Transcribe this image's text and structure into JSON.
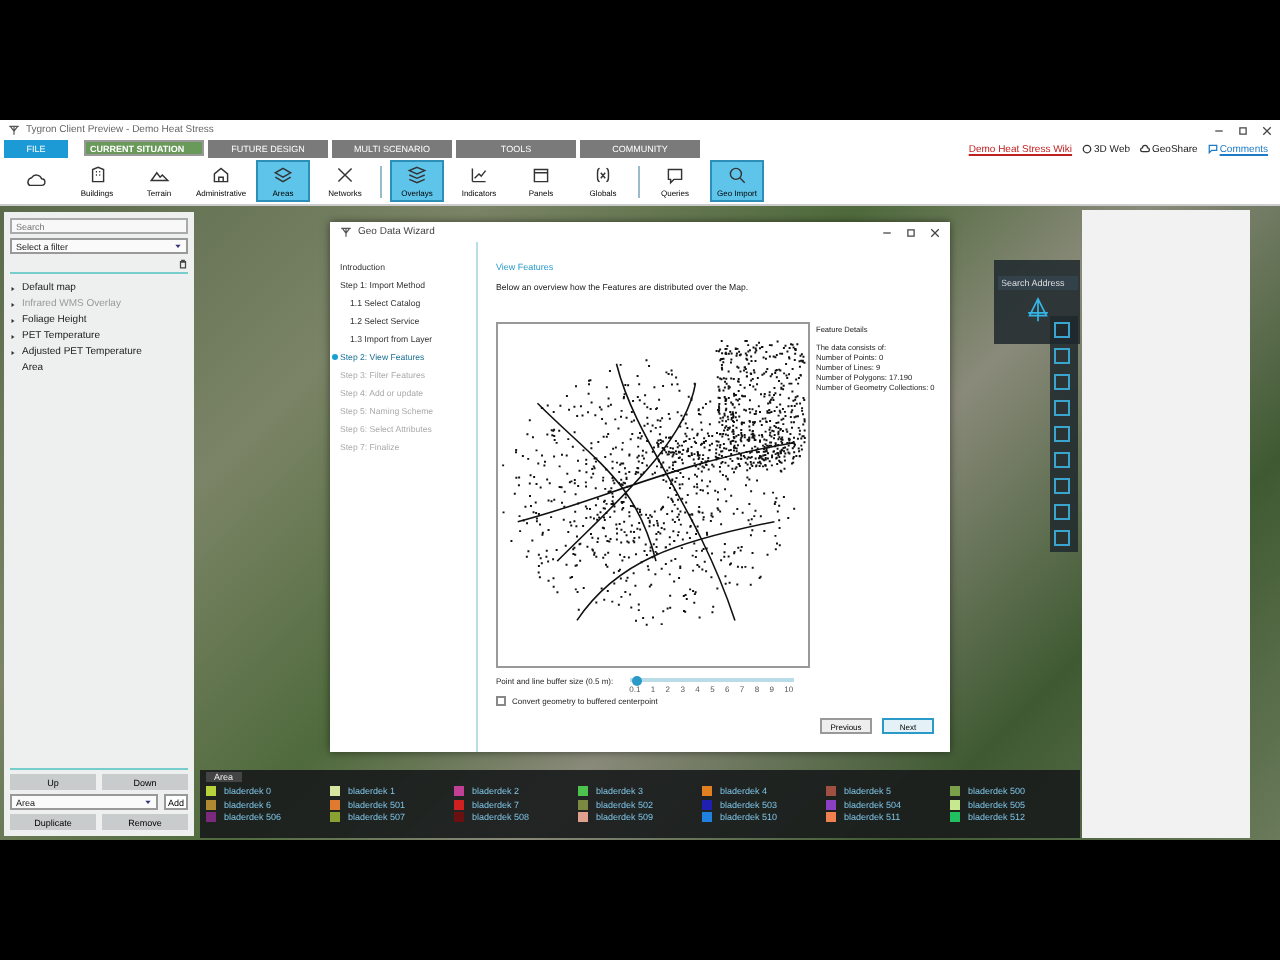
{
  "window": {
    "title": "Tygron Client Preview - Demo Heat Stress"
  },
  "tabs": [
    {
      "label": "FILE",
      "selected": false,
      "color": "#1c9ad6"
    },
    {
      "label": "CURRENT SITUATION",
      "selected": true,
      "color": "#6a9a5a"
    },
    {
      "label": "FUTURE DESIGN",
      "selected": false,
      "color": "#7a7a7a"
    },
    {
      "label": "MULTI SCENARIO",
      "selected": false,
      "color": "#7a7a7a"
    },
    {
      "label": "TOOLS",
      "selected": false,
      "color": "#7a7a7a"
    },
    {
      "label": "COMMUNITY",
      "selected": false,
      "color": "#7a7a7a"
    }
  ],
  "header_links": [
    {
      "label": "Demo Heat Stress Wiki",
      "kind": "link"
    },
    {
      "label": "3D Web",
      "kind": "globe"
    },
    {
      "label": "GeoShare",
      "kind": "cloud"
    },
    {
      "label": "Comments",
      "kind": "chat"
    }
  ],
  "toolbar": [
    [
      {
        "selected": false
      },
      {
        "label": "Buildings",
        "selected": false
      },
      {
        "label": "Terrain",
        "selected": false
      },
      {
        "label": "Administrative",
        "selected": false
      },
      {
        "label": "Areas",
        "selected": true
      },
      {
        "label": "Networks",
        "selected": false
      }
    ],
    [
      {
        "label": "Overlays",
        "selected": true
      },
      {
        "label": "Indicators",
        "selected": false
      },
      {
        "label": "Panels",
        "selected": false
      },
      {
        "label": "Globals",
        "selected": false
      }
    ],
    [
      {
        "label": "Queries",
        "selected": false
      },
      {
        "label": "Geo Import",
        "selected": true
      }
    ]
  ],
  "sidebar": {
    "search": {
      "placeholder": "Search"
    },
    "filter": "Select a filter",
    "items": [
      {
        "label": "Default map",
        "disabled": false,
        "expandable": true
      },
      {
        "label": "Infrared WMS Overlay",
        "disabled": true,
        "expandable": true
      },
      {
        "label": "Foliage Height",
        "disabled": false,
        "expandable": true
      },
      {
        "label": "PET Temperature",
        "disabled": false,
        "expandable": true
      },
      {
        "label": "Adjusted PET Temperature",
        "disabled": false,
        "expandable": true
      },
      {
        "label": "Area",
        "disabled": false,
        "expandable": false
      }
    ],
    "move_buttons": [
      "Up",
      "Down"
    ],
    "type_select": "Area",
    "add_button": "Add",
    "action_buttons": [
      "Duplicate",
      "Remove"
    ]
  },
  "wizard": {
    "title": "Geo Data Wizard",
    "steps": [
      {
        "label": "Introduction",
        "selected": false,
        "disabled": false
      },
      {
        "label": "Step 1: Import Method",
        "selected": false,
        "disabled": false,
        "children": [
          {
            "label": "1.1 Select Catalog",
            "selected": false,
            "disabled": false
          },
          {
            "label": "1.2 Select Service",
            "selected": false,
            "disabled": false
          },
          {
            "label": "1.3 Import from Layer",
            "selected": false,
            "disabled": false
          }
        ]
      },
      {
        "label": "Step 2: View Features",
        "selected": true,
        "disabled": false
      },
      {
        "label": "Step 3: Filter Features",
        "selected": false,
        "disabled": true
      },
      {
        "label": "Step 4: Add or update",
        "selected": false,
        "disabled": true
      },
      {
        "label": "Step 5: Naming Scheme",
        "selected": false,
        "disabled": true
      },
      {
        "label": "Step 6: Select Attributes",
        "selected": false,
        "disabled": true
      },
      {
        "label": "Step 7: Finalize",
        "selected": false,
        "disabled": true
      }
    ],
    "heading": "View Features",
    "description": "Below an overview how the Features are distributed over the Map.",
    "details": [
      "Feature Details",
      "The data consists of:",
      "Number of Points: 0",
      "Number of Lines: 9",
      "Number of Polygons: 17.190",
      "Number of Geometry Collections: 0"
    ],
    "slider": {
      "label": "Point and line buffer size (0.5 m):",
      "level": 0.05,
      "ticks": [
        "0.1",
        "1",
        "2",
        "3",
        "4",
        "5",
        "6",
        "7",
        "8",
        "9",
        "10"
      ]
    },
    "checkbox": {
      "label": "Convert geometry to buffered centerpoint",
      "checked": false
    },
    "buttons": [
      {
        "label": "Previous",
        "kind": "normal"
      },
      {
        "label": "Next",
        "kind": "default"
      }
    ]
  },
  "map_search": {
    "placeholder": "Search Address"
  },
  "legend": {
    "title": "Area",
    "items": [
      {
        "label": "bladerdek 0",
        "color": "#b7d23a"
      },
      {
        "label": "bladerdek 1",
        "color": "#d4e6a0"
      },
      {
        "label": "bladerdek 2",
        "color": "#c23f96"
      },
      {
        "label": "bladerdek 3",
        "color": "#4cc34c"
      },
      {
        "label": "bladerdek 4",
        "color": "#e08020"
      },
      {
        "label": "bladerdek 5",
        "color": "#a05040"
      },
      {
        "label": "bladerdek 500",
        "color": "#7aa04a"
      },
      {
        "label": "bladerdek 6",
        "color": "#b08a30"
      },
      {
        "label": "bladerdek 501",
        "color": "#e07a30"
      },
      {
        "label": "bladerdek 7",
        "color": "#d02020"
      },
      {
        "label": "bladerdek 502",
        "color": "#7a8a40"
      },
      {
        "label": "bladerdek 503",
        "color": "#2020b0"
      },
      {
        "label": "bladerdek 504",
        "color": "#8a40c0"
      },
      {
        "label": "bladerdek 505",
        "color": "#c8e890"
      },
      {
        "label": "bladerdek 506",
        "color": "#7a2a7a"
      },
      {
        "label": "bladerdek 507",
        "color": "#8aa030"
      },
      {
        "label": "bladerdek 508",
        "color": "#6a1010"
      },
      {
        "label": "bladerdek 509",
        "color": "#e0a090"
      },
      {
        "label": "bladerdek 510",
        "color": "#2080e0"
      },
      {
        "label": "bladerdek 511",
        "color": "#f08050"
      },
      {
        "label": "bladerdek 512",
        "color": "#20c060"
      }
    ]
  }
}
